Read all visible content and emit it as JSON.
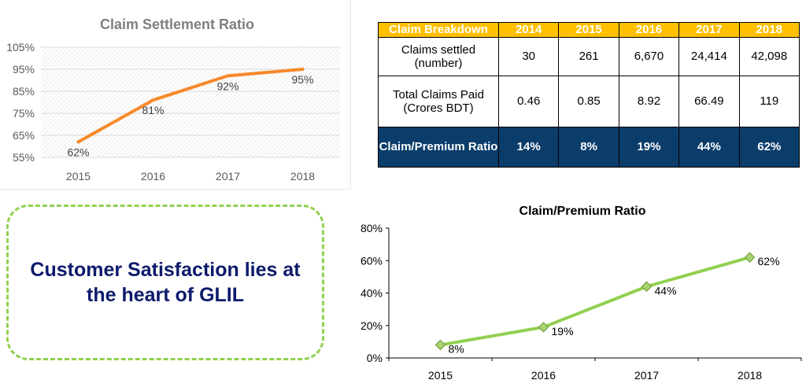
{
  "chart_data": [
    {
      "type": "line",
      "title": "Claim Settlement Ratio",
      "categories": [
        "2015",
        "2016",
        "2017",
        "2018"
      ],
      "values": [
        62,
        81,
        92,
        95
      ],
      "data_labels": [
        "62%",
        "81%",
        "92%",
        "95%"
      ],
      "y_ticks": [
        "55%",
        "65%",
        "75%",
        "85%",
        "95%",
        "105%"
      ],
      "ylim": [
        55,
        105
      ],
      "grid": true,
      "line_color": "#f7892a"
    },
    {
      "type": "line",
      "title": "Claim/Premium Ratio",
      "categories": [
        "2015",
        "2016",
        "2017",
        "2018"
      ],
      "values": [
        8,
        19,
        44,
        62
      ],
      "data_labels": [
        "8%",
        "19%",
        "44%",
        "62%"
      ],
      "y_ticks": [
        "0%",
        "20%",
        "40%",
        "60%",
        "80%"
      ],
      "ylim": [
        0,
        80
      ],
      "grid": false,
      "line_color": "#92d050",
      "marker": "diamond"
    },
    {
      "type": "table",
      "header": [
        "Claim Breakdown",
        "2014",
        "2015",
        "2016",
        "2017",
        "2018"
      ],
      "rows": [
        {
          "label": "Claims settled (number)",
          "values": [
            "30",
            "261",
            "6,670",
            "24,414",
            "42,098"
          ]
        },
        {
          "label": "Total Claims Paid (Crores BDT)",
          "values": [
            "0.46",
            "0.85",
            "8.92",
            "66.49",
            "119"
          ]
        },
        {
          "label": "Claim/Premium Ratio",
          "values": [
            "14%",
            "8%",
            "19%",
            "44%",
            "62%"
          ]
        }
      ]
    }
  ],
  "table": {
    "header": [
      "Claim Breakdown",
      "2014",
      "2015",
      "2016",
      "2017",
      "2018"
    ],
    "row1_label": "Claims settled (number)",
    "row1": [
      "30",
      "261",
      "6,670",
      "24,414",
      "42,098"
    ],
    "row2_label": "Total Claims Paid (Crores BDT)",
    "row2": [
      "0.46",
      "0.85",
      "8.92",
      "66.49",
      "119"
    ],
    "row3_label": "Claim/Premium Ratio",
    "row3": [
      "14%",
      "8%",
      "19%",
      "44%",
      "62%"
    ]
  },
  "callout": {
    "text": "Customer Satisfaction lies at the heart of GLIL"
  },
  "colors": {
    "table_header": "#ffc000",
    "table_highlight_row": "#0b3d6b",
    "callout_text": "#0d1a6b",
    "callout_border": "#92d050"
  }
}
